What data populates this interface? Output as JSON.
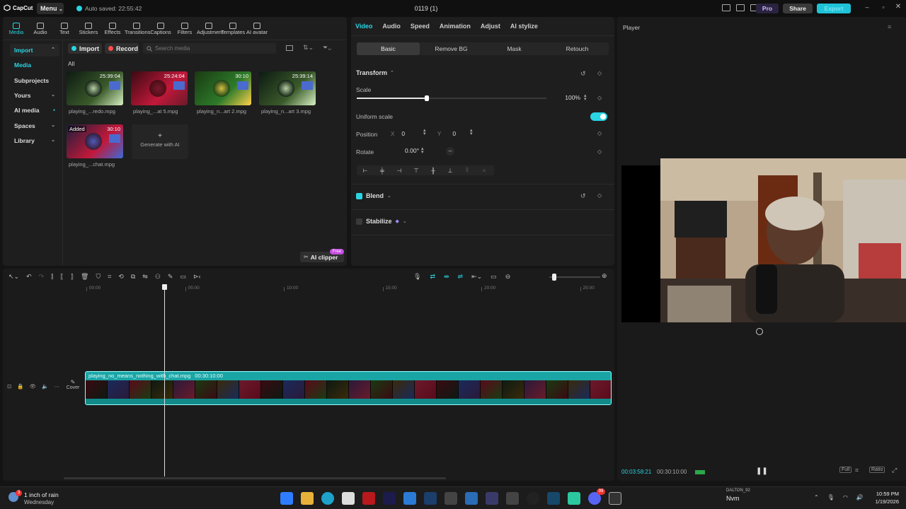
{
  "app": {
    "name": "CapCut",
    "menu_label": "Menu",
    "autosave": "Auto saved: 22:55:42",
    "project_title": "0119 (1)",
    "pro_label": "Pro",
    "share_label": "Share",
    "export_label": "Export"
  },
  "toolbar": [
    {
      "label": "Media",
      "icon": "media-icon"
    },
    {
      "label": "Audio",
      "icon": "audio-icon"
    },
    {
      "label": "Text",
      "icon": "text-icon"
    },
    {
      "label": "Stickers",
      "icon": "stickers-icon"
    },
    {
      "label": "Effects",
      "icon": "effects-icon"
    },
    {
      "label": "Transitions",
      "icon": "transitions-icon"
    },
    {
      "label": "Captions",
      "icon": "captions-icon"
    },
    {
      "label": "Filters",
      "icon": "filters-icon"
    },
    {
      "label": "Adjustment",
      "icon": "adjustment-icon"
    },
    {
      "label": "Templates",
      "icon": "templates-icon"
    },
    {
      "label": "AI avatar",
      "icon": "ai-avatar-icon"
    }
  ],
  "sidebar": {
    "items": [
      {
        "label": "Import"
      },
      {
        "label": "Media"
      },
      {
        "label": "Subprojects"
      },
      {
        "label": "Yours"
      },
      {
        "label": "AI media"
      },
      {
        "label": "Spaces"
      },
      {
        "label": "Library"
      }
    ]
  },
  "media": {
    "import_label": "Import",
    "record_label": "Record",
    "search_placeholder": "Search media",
    "filter_all": "All",
    "items": [
      {
        "name": "playing_...redo.mpg",
        "duration": "25:39:04"
      },
      {
        "name": "playing_...at 5.mpg",
        "duration": "25:24:04"
      },
      {
        "name": "playing_n...art 2.mpg",
        "duration": "30:10"
      },
      {
        "name": "playing_n...art 3.mpg",
        "duration": "25:39:14"
      },
      {
        "name": "playing_...chat.mpg",
        "duration": "30:10",
        "badge": "Added"
      }
    ],
    "generate_label": "Generate with AI",
    "ai_clipper_label": "AI clipper",
    "free_badge": "Free"
  },
  "properties": {
    "tabs": [
      "Video",
      "Audio",
      "Speed",
      "Animation",
      "Adjust",
      "AI stylize"
    ],
    "subtabs": [
      "Basic",
      "Remove BG",
      "Mask",
      "Retouch"
    ],
    "transform_label": "Transform",
    "scale_label": "Scale",
    "scale_value": "100%",
    "scale_fraction": 0.37,
    "uniform_scale_label": "Uniform scale",
    "position_label": "Position",
    "pos_x_label": "X",
    "pos_x": "0",
    "pos_y_label": "Y",
    "pos_y": "0",
    "rotate_label": "Rotate",
    "rotate_value": "0.00°",
    "blend_label": "Blend",
    "stabilize_label": "Stabilize"
  },
  "player": {
    "title": "Player",
    "current_time": "00:03:58:21",
    "total_time": "00:30:10:00",
    "full_label": "Full",
    "ratio_label": "Ratio"
  },
  "timeline": {
    "ruler": [
      "00:00",
      "05:00",
      "10:00",
      "15:00",
      "20:00",
      "25:00"
    ],
    "clip_name": "playing_no_means_nothing_with_chat.mpg",
    "clip_duration": "00:30:10:00",
    "cover_label": "Cover"
  },
  "taskbar": {
    "weather_title": "1 inch of rain",
    "weather_sub": "Wednesday",
    "weather_badge": "3",
    "media_artist": "DALTON_92",
    "media_title": "Nvm",
    "time": "10:59 PM",
    "date": "1/19/2026",
    "chat_badge": "99"
  },
  "colors": {
    "accent": "#2bd4e3",
    "export_bg": "#1fc3d8",
    "clip_teal": "#1aa5a5",
    "pro_purple": "#7b5cff"
  }
}
